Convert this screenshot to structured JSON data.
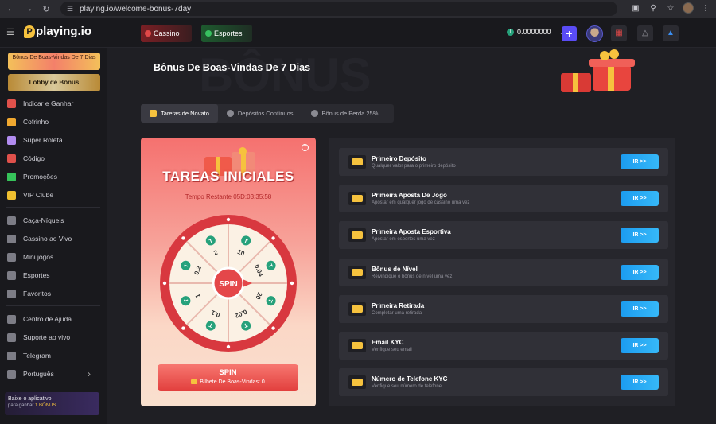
{
  "browser": {
    "url": "playing.io/welcome-bonus-7day"
  },
  "header": {
    "logo": "playing.io",
    "logo_letter": "P",
    "tabs": [
      {
        "label": "Cassino"
      },
      {
        "label": "Esportes"
      }
    ],
    "balance": "0.0000000",
    "coin_symbol": "T"
  },
  "sidebar": {
    "promo_top": "Bônus De Boas-Vindas De 7 Dias",
    "promo_lobby": "Lobby de Bônus",
    "groups": [
      [
        {
          "label": "Indicar e Ganhar",
          "icon": "gift-icon",
          "color": "#e0514b"
        },
        {
          "label": "Cofrinho",
          "icon": "piggy-bank-icon",
          "color": "#f0a830"
        },
        {
          "label": "Super Roleta",
          "icon": "roulette-icon",
          "color": "#b28cf0"
        },
        {
          "label": "Código",
          "icon": "code-icon",
          "color": "#e0514b"
        },
        {
          "label": "Promoções",
          "icon": "check-circle-icon",
          "color": "#36c35a"
        },
        {
          "label": "VIP Clube",
          "icon": "vip-icon",
          "color": "#f0c030"
        }
      ],
      [
        {
          "label": "Caça-Níqueis",
          "icon": "slot-machine-icon",
          "color": "#7d7d86"
        },
        {
          "label": "Cassino ao Vivo",
          "icon": "live-casino-icon",
          "color": "#7d7d86"
        },
        {
          "label": "Mini jogos",
          "icon": "gamepad-icon",
          "color": "#7d7d86"
        },
        {
          "label": "Esportes",
          "icon": "sports-ball-icon",
          "color": "#7d7d86"
        },
        {
          "label": "Favoritos",
          "icon": "heart-icon",
          "color": "#7d7d86"
        }
      ],
      [
        {
          "label": "Centro de Ajuda",
          "icon": "chat-icon",
          "color": "#7d7d86"
        },
        {
          "label": "Suporte ao vivo",
          "icon": "headset-icon",
          "color": "#7d7d86"
        },
        {
          "label": "Telegram",
          "icon": "telegram-icon",
          "color": "#7d7d86"
        },
        {
          "label": "Português",
          "icon": "globe-icon",
          "color": "#7d7d86"
        }
      ]
    ],
    "app_banner": {
      "title": "Baixe o aplicativo",
      "subtitle": "para ganhar",
      "bonus": "1 BÔNUS"
    }
  },
  "main": {
    "title": "Bônus De Boas-Vindas De 7 Dias",
    "subtabs": [
      {
        "label": "Tarefas de Novato",
        "active": true
      },
      {
        "label": "Depósitos Contínuos",
        "active": false
      },
      {
        "label": "Bônus de Perda 25%",
        "active": false
      }
    ],
    "wheel": {
      "title": "TAREAS INICIALES",
      "timer_label": "Tempo Restante",
      "timer_value": "05D:03:35:58",
      "center_label": "SPIN",
      "segments": [
        "10",
        "0.04",
        "20",
        "0.02",
        "0.1",
        "1",
        "0.2",
        "2"
      ],
      "spin_label": "SPIN",
      "ticket_label": "Bilhete De Boas-Vindas",
      "ticket_count": "0"
    },
    "tasks": [
      {
        "name": "Primeiro Depósito",
        "desc": "Qualquer valor para o primeiro depósito",
        "button": "IR >>"
      },
      {
        "name": "Primeira Aposta De Jogo",
        "desc": "Apostar em qualquer jogo de cassino uma vez",
        "button": "IR >>"
      },
      {
        "name": "Primeira Aposta Esportiva",
        "desc": "Apostar em esportes uma vez",
        "button": "IR >>"
      },
      {
        "name": "Bônus de Nível",
        "desc": "Reivindique o bônus de nível uma vez",
        "button": "IR >>"
      },
      {
        "name": "Primeira Retirada",
        "desc": "Completar uma retirada",
        "button": "IR >>"
      },
      {
        "name": "Email KYC",
        "desc": "Verifique seu email",
        "button": "IR >>"
      },
      {
        "name": "Número de Telefone KYC",
        "desc": "Verifique seu número de telefone",
        "button": "IR >>"
      }
    ]
  }
}
